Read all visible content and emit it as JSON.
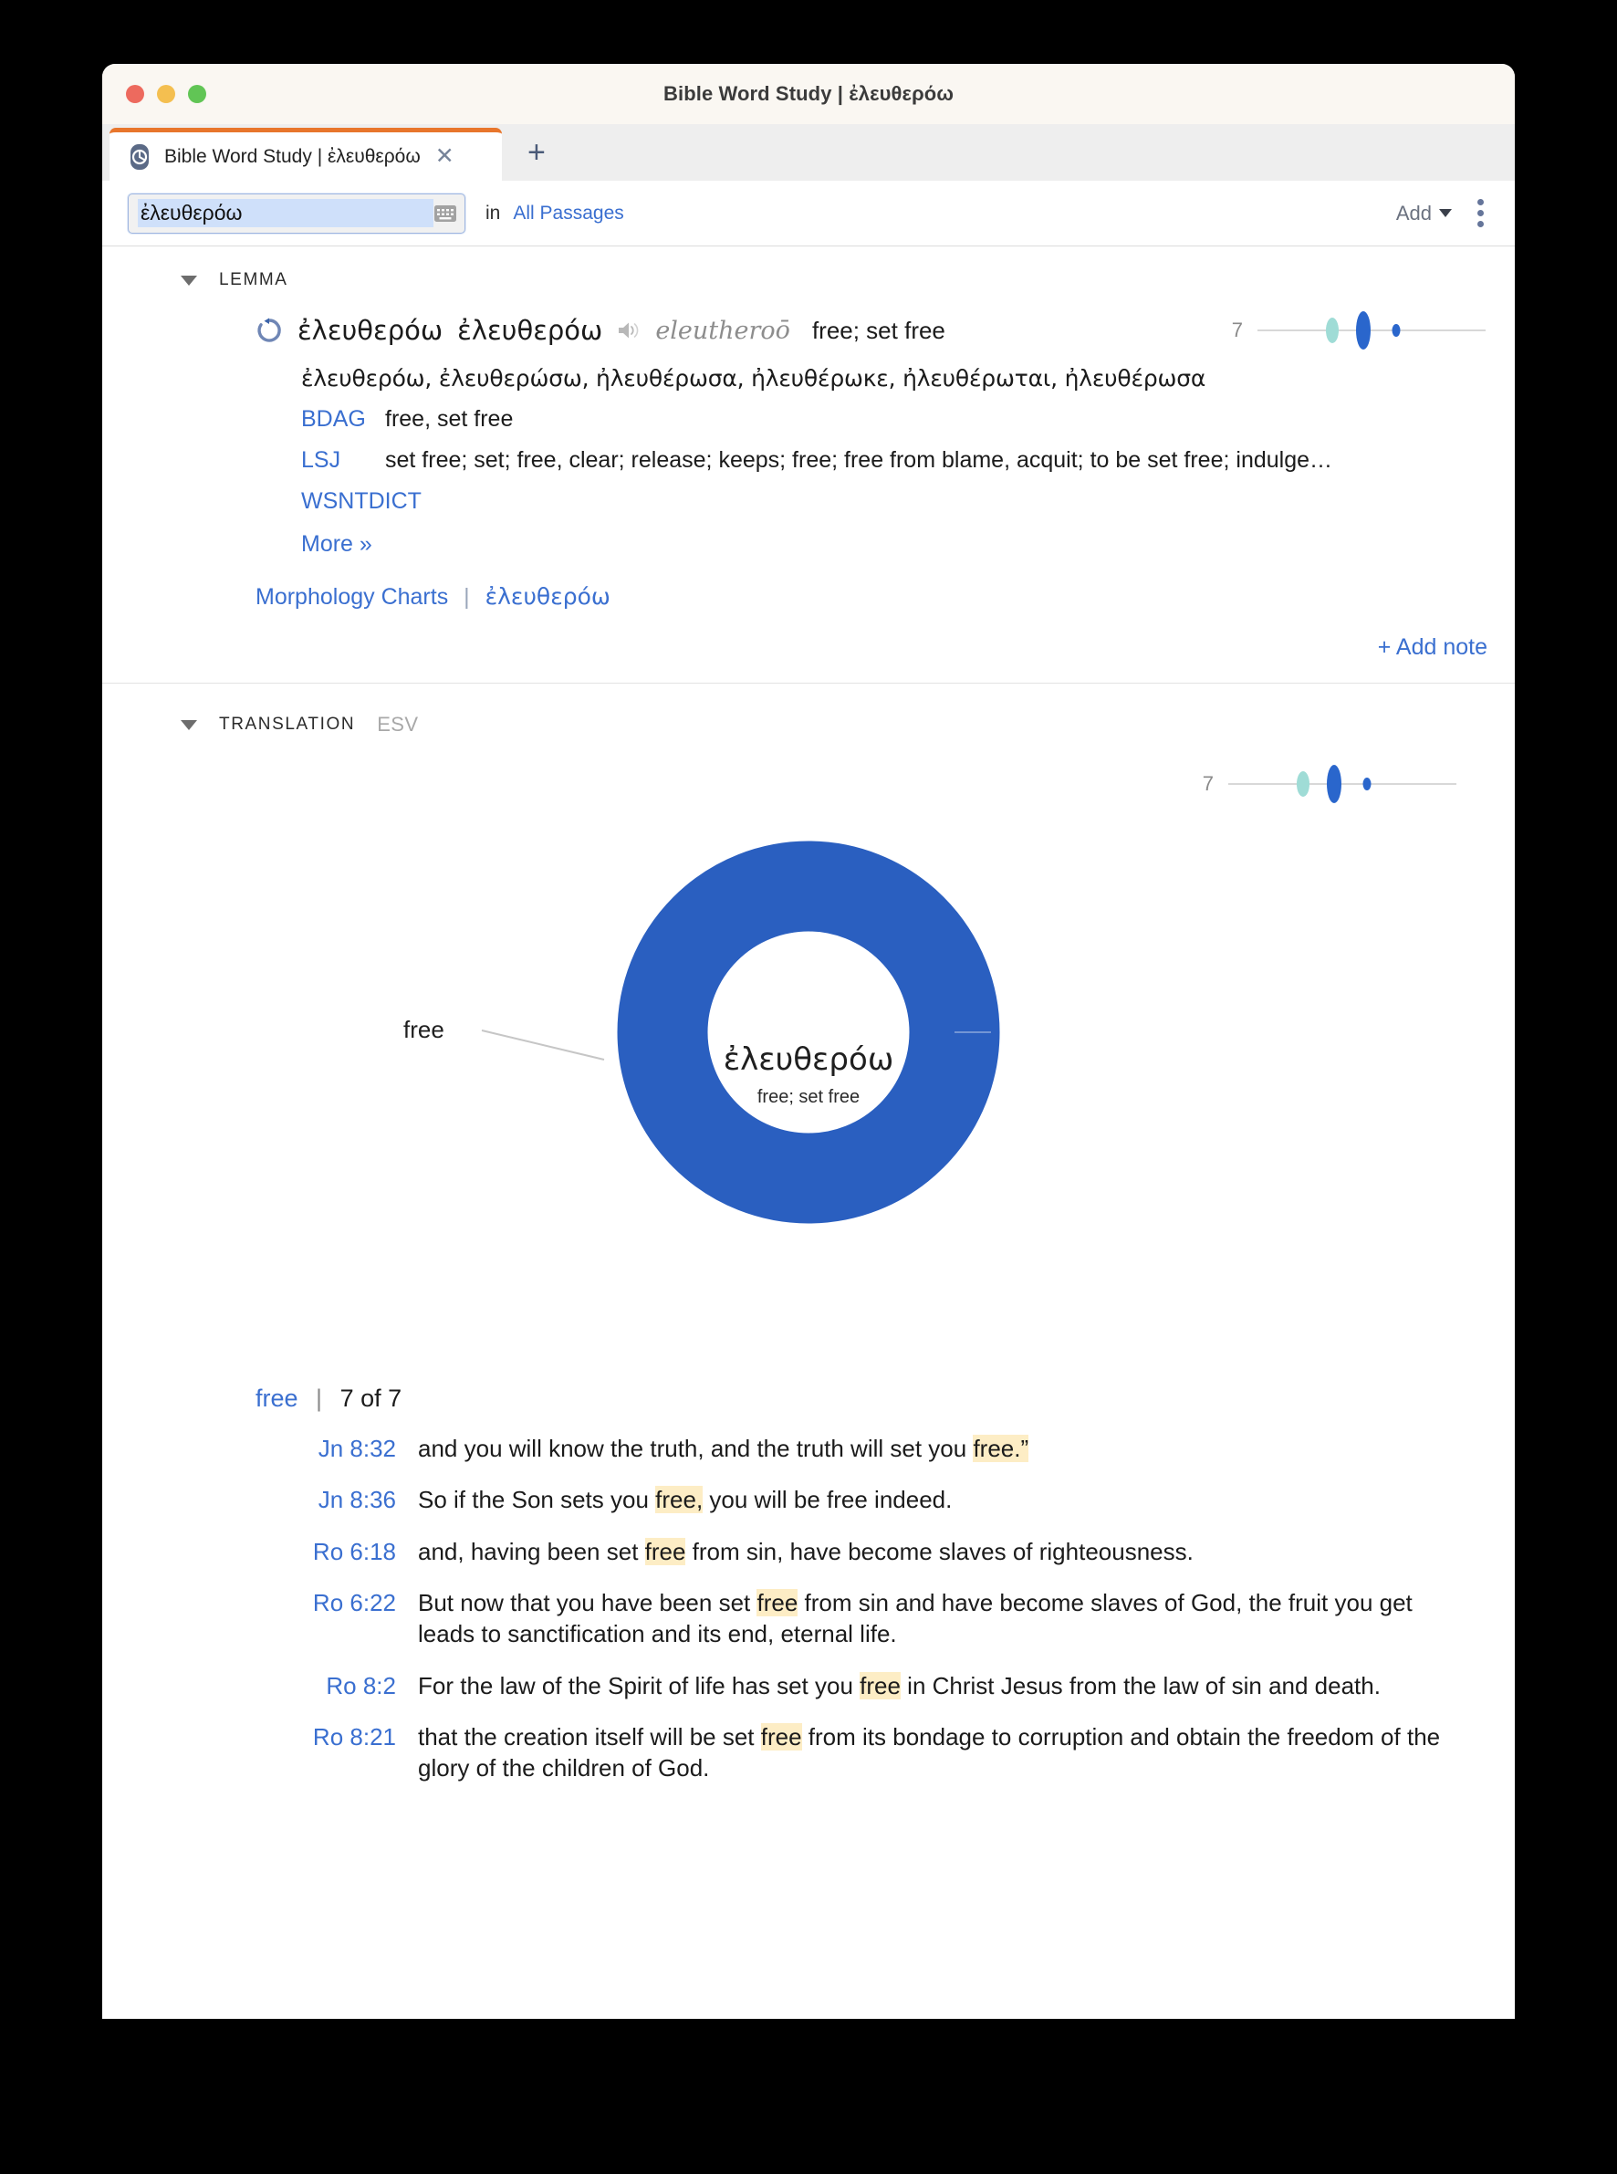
{
  "window": {
    "title": "Bible Word Study | ἐλευθερόω",
    "traffic_lights": [
      "close",
      "minimize",
      "maximize"
    ]
  },
  "tabs": {
    "active_label": "Bible Word Study | ἐλευθερόω",
    "close_label": "✕",
    "new_tab_label": "+"
  },
  "toolbar": {
    "search_value": "ἐλευθερόω",
    "search_placeholder": "ἐλευθερόω",
    "in_label": "in",
    "scope_label": "All Passages",
    "add_label": "Add"
  },
  "lemma": {
    "section_title": "LEMMA",
    "headword": "ἐλευθερόω",
    "headword_repeat": "ἐλευθερόω",
    "transliteration": "eleutheroō",
    "gloss": "free; set free",
    "principal_parts": "ἐλευθερόω, ἐλευθερώσω, ἠλευθέρωσα, ἠλευθέρωκε, ἠλευθέρωται, ἠλευθέρωσα",
    "dictionaries": [
      {
        "key": "BDAG",
        "value": "free, set free"
      },
      {
        "key": "LSJ",
        "value": "set free; set; free, clear; release; keeps; free; free from blame, acquit; to be set free; indulge…"
      },
      {
        "key": "WSNTDICT",
        "value": ""
      }
    ],
    "more_label": "More »",
    "morphology_label": "Morphology Charts",
    "morphology_pipe": "|",
    "morphology_word": "ἐλευθερόω",
    "add_note_label": "+ Add note",
    "sparkline_count": "7"
  },
  "translation": {
    "section_title": "TRANSLATION",
    "version": "ESV",
    "sparkline_count": "7",
    "donut_center_word": "ἐλευθερόω",
    "donut_center_gloss": "free; set free",
    "slice_label": "free",
    "donut_color": "#2a5fc0"
  },
  "chart_data": {
    "type": "pie",
    "title": "ἐλευθερόω",
    "subtitle": "free; set free",
    "categories": [
      "free"
    ],
    "values": [
      7
    ],
    "percentages": [
      100
    ],
    "colors": [
      "#2a5fc0"
    ],
    "total": 7,
    "legend_position": "callout-left",
    "hole_ratio": 0.64
  },
  "verses": {
    "word_link": "free",
    "pipe": "|",
    "count_label": "7 of 7",
    "items": [
      {
        "ref": "Jn 8:32",
        "pre": "and you will know the truth, and the truth will set you ",
        "hl": "free.”",
        "post": ""
      },
      {
        "ref": "Jn 8:36",
        "pre": "So if the Son sets you ",
        "hl": "free,",
        "post": " you will be free indeed."
      },
      {
        "ref": "Ro 6:18",
        "pre": "and, having been set ",
        "hl": "free",
        "post": " from sin, have become slaves of righteousness."
      },
      {
        "ref": "Ro 6:22",
        "pre": "But now that you have been set ",
        "hl": "free",
        "post": " from sin and have become slaves of God, the fruit you get leads to sanctification and its end, eternal life."
      },
      {
        "ref": "Ro 8:2",
        "pre": "For the law of the Spirit of life has set you ",
        "hl": "free",
        "post": " in Christ Jesus from the law of sin and death."
      },
      {
        "ref": "Ro 8:21",
        "pre": "that the creation itself will be set ",
        "hl": "free",
        "post": " from its bondage to corruption and obtain the freedom of the glory of the children of God."
      }
    ]
  }
}
